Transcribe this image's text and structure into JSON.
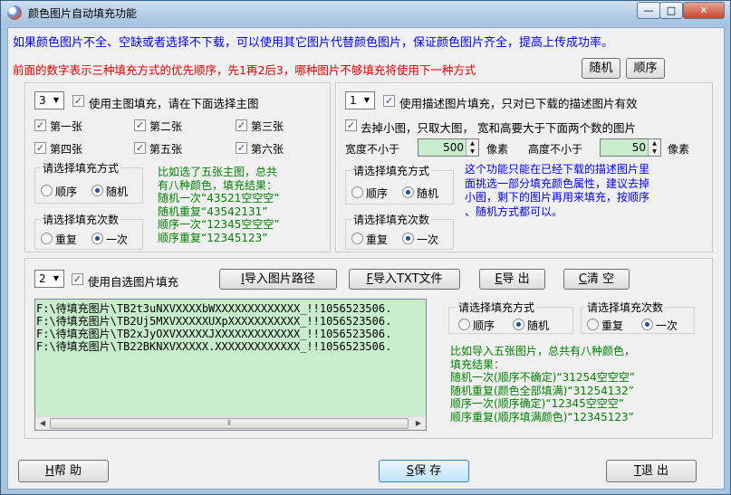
{
  "window": {
    "title": "颜色图片自动填充功能",
    "min_glyph": "—",
    "max_glyph": "□",
    "close_glyph": "✕"
  },
  "header": {
    "info_line": "如果颜色图片不全、空缺或者选择不下载，可以使用其它图片代替颜色图片，保证颜色图片齐全，提高上传成功率。",
    "priority_line": "前面的数字表示三种填充方式的优先顺序，先1再2后3，哪种图片不够填充将使用下一种方式",
    "random_button": "随机",
    "order_button": "顺序"
  },
  "main_image": {
    "priority": "3",
    "use_label": "使用主图填充，请在下面选择主图",
    "images": [
      {
        "label": "第一张",
        "checked": true
      },
      {
        "label": "第二张",
        "checked": true
      },
      {
        "label": "第三张",
        "checked": true
      },
      {
        "label": "第四张",
        "checked": true
      },
      {
        "label": "第五张",
        "checked": true
      },
      {
        "label": "第六张",
        "checked": true
      }
    ],
    "mode_title": "请选择填充方式",
    "mode_order": "顺序",
    "mode_random": "随机",
    "count_title": "请选择填充次数",
    "count_repeat": "重复",
    "count_once": "一次",
    "example": [
      "比如选了五张主图，总共",
      "有八种颜色，填充结果：",
      "随机一次“43521空空空”",
      "随机重复“43542131”",
      "顺序一次“12345空空空”",
      "顺序重复“12345123”"
    ]
  },
  "desc_image": {
    "priority": "1",
    "use_label": "使用描述图片填充，只对已下载的描述图片有效",
    "remove_small_label": "去掉小图，只取大图，  宽和高要大于下面两个数的图片",
    "width_label": "宽度不小于",
    "width_value": "500",
    "height_label": "高度不小于",
    "height_value": "50",
    "unit": "像素",
    "mode_title": "请选择填充方式",
    "mode_order": "顺序",
    "mode_random": "随机",
    "count_title": "请选择填充次数",
    "count_repeat": "重复",
    "count_once": "一次",
    "note": [
      "这个功能只能在已经下载的描述图片里",
      "面挑选一部分填充颜色属性，建议去掉",
      "小图，剩下的图片再用来填充，按顺序",
      "、随机方式都可以。"
    ]
  },
  "custom_image": {
    "priority": "2",
    "use_label": "使用自选图片填充",
    "import_path_button": {
      "key": "I",
      "text": "导入图片路径"
    },
    "import_txt_button": {
      "key": "F",
      "text": "导入TXT文件"
    },
    "export_button": {
      "key": "E",
      "text": "导 出"
    },
    "clear_button": {
      "key": "C",
      "text": "清 空"
    },
    "paths": [
      "F:\\待填充图片\\TB2t3uNXVXXXXbWXXXXXXXXXXXXX_!!1056523506.",
      "F:\\待填充图片\\TB2Uj5MXVXXXXXUXpXXXXXXXXXXX_!!1056523506.",
      "F:\\待填充图片\\TB2xJyOXVXXXXXJXXXXXXXXXXXXX_!!1056523506.",
      "F:\\待填充图片\\TB22BKNXVXXXXX.XXXXXXXXXXXXX_!!1056523506."
    ],
    "mode_title": "请选择填充方式",
    "mode_order": "顺序",
    "mode_random": "随机",
    "count_title": "请选择填充次数",
    "count_repeat": "重复",
    "count_once": "一次",
    "example": [
      "比如导入五张图片，总共有八种颜色，",
      "填充结果：",
      "随机一次(顺序不确定)“31254空空空”",
      "随机重复(颜色全部填满)“31254132”",
      "顺序一次(顺序确定)“12345空空空”",
      "顺序重复(顺序填满颜色)“12345123”"
    ]
  },
  "footer": {
    "help_button": {
      "key": "H",
      "text": "帮  助"
    },
    "save_button": {
      "key": "S",
      "text": "保  存"
    },
    "exit_button": {
      "key": "T",
      "text": "退  出"
    }
  }
}
